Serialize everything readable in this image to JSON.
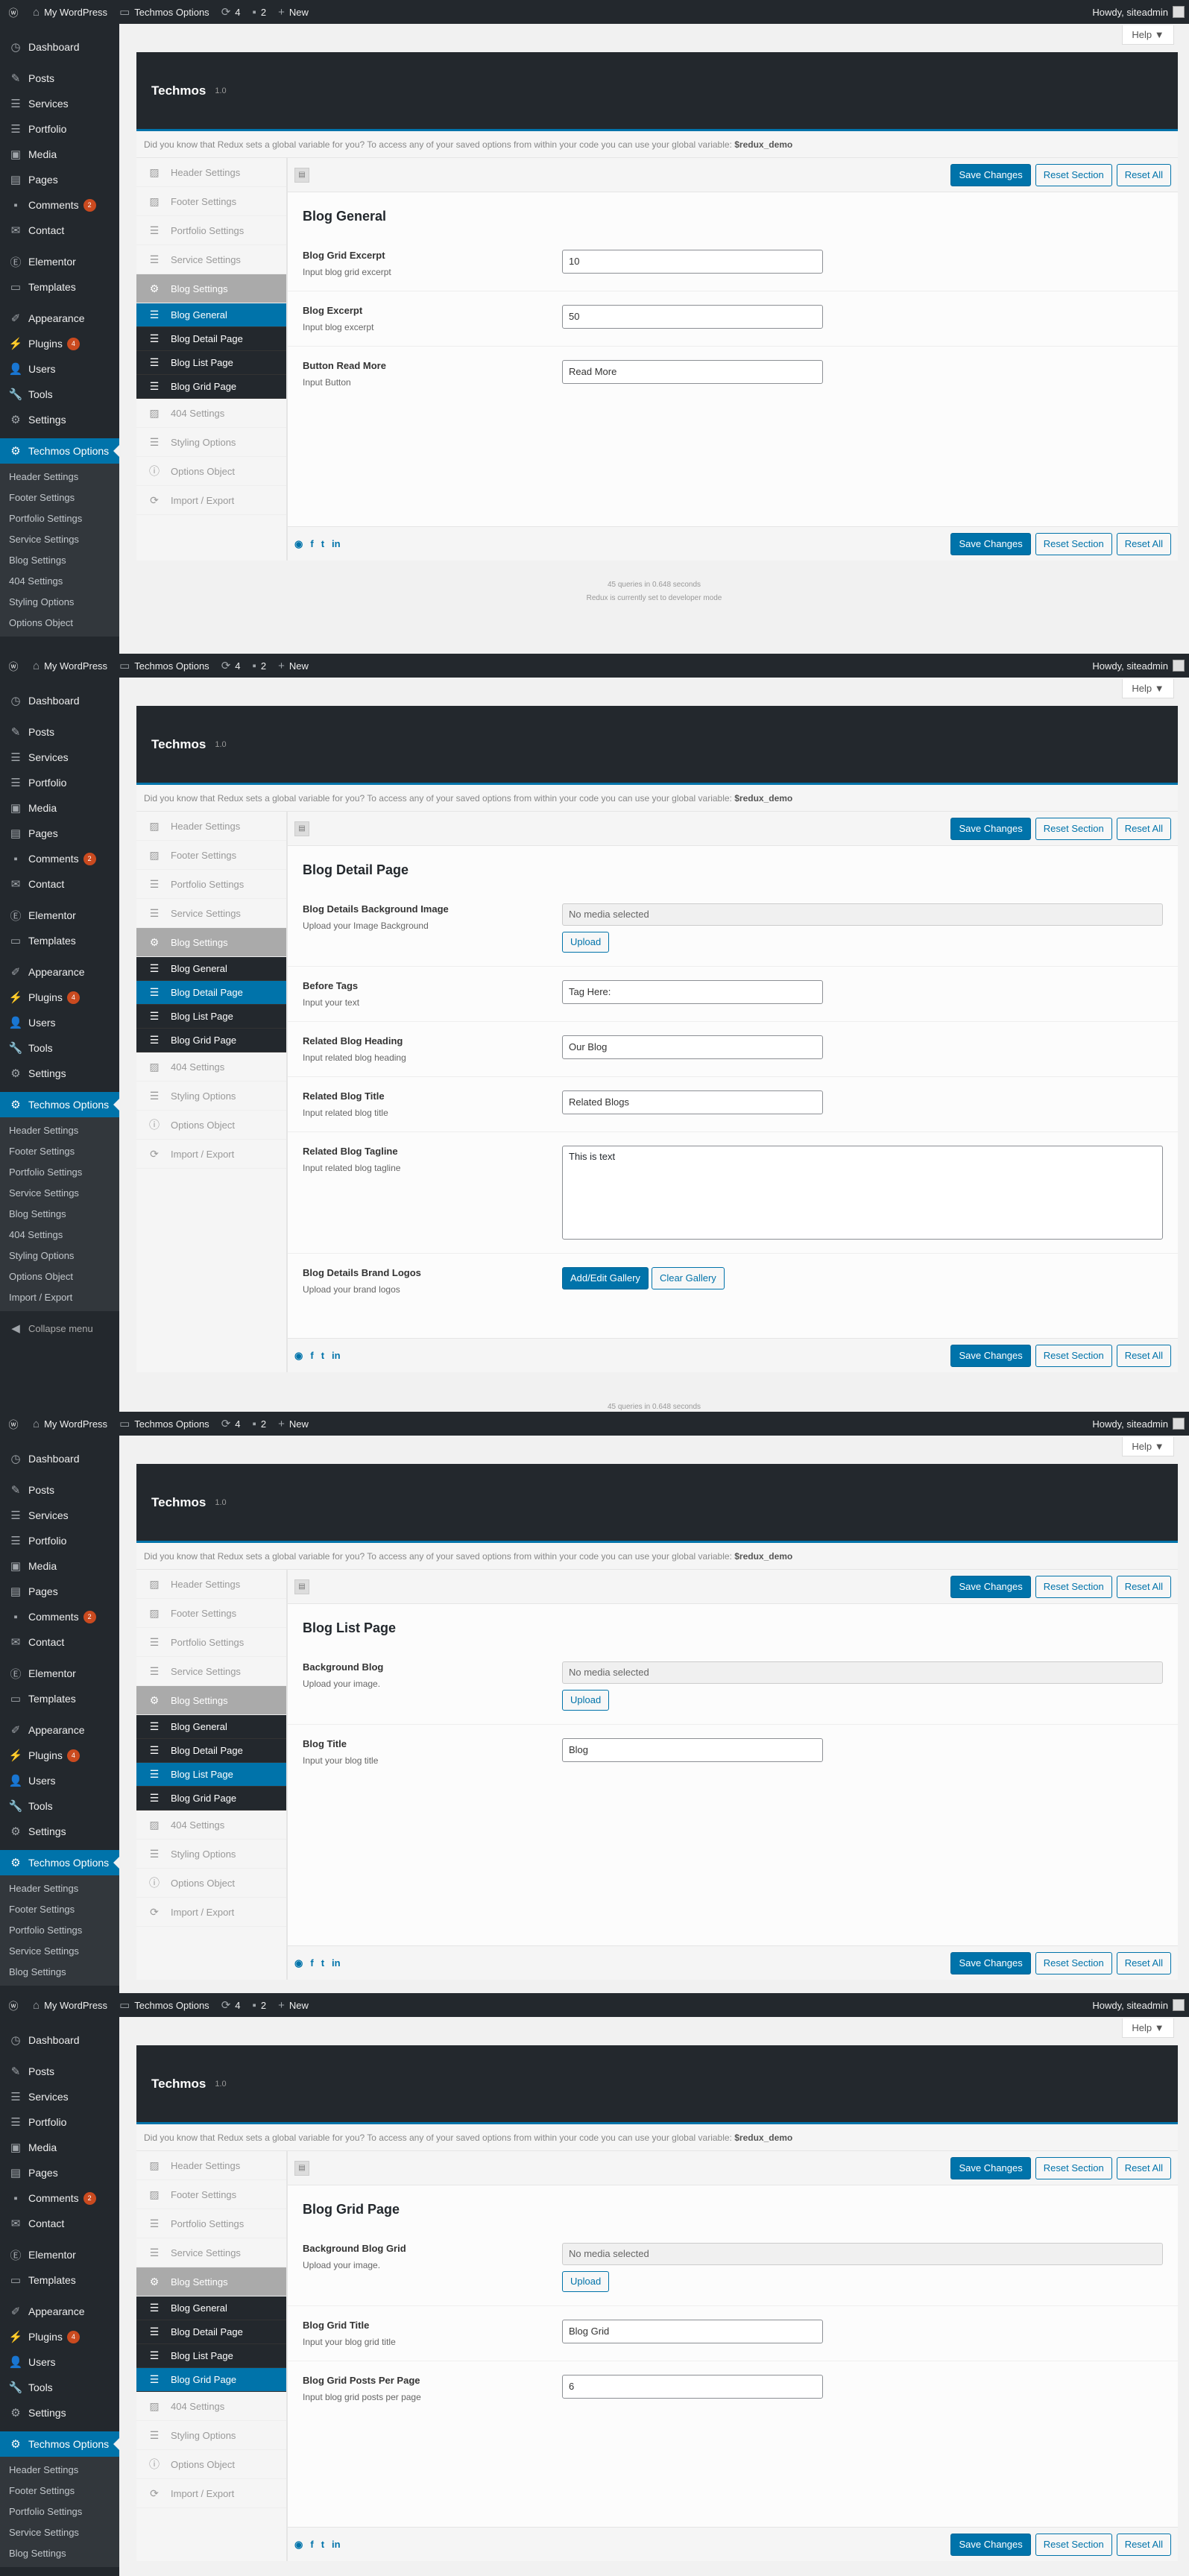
{
  "adminbar": {
    "site": "My WordPress",
    "techmos": "Techmos Options",
    "updates": "4",
    "comments": "2",
    "new": "New",
    "howdy": "Howdy, siteadmin"
  },
  "menu": {
    "dashboard": "Dashboard",
    "posts": "Posts",
    "services": "Services",
    "portfolio": "Portfolio",
    "media": "Media",
    "pages": "Pages",
    "comments": "Comments",
    "comments_badge": "2",
    "contact": "Contact",
    "elementor": "Elementor",
    "templates": "Templates",
    "appearance": "Appearance",
    "plugins": "Plugins",
    "plugins_badge": "4",
    "users": "Users",
    "tools": "Tools",
    "settings": "Settings",
    "techmos_options": "Techmos Options",
    "collapse": "Collapse menu",
    "sub": [
      "Header Settings",
      "Footer Settings",
      "Portfolio Settings",
      "Service Settings",
      "Blog Settings",
      "404 Settings",
      "Styling Options",
      "Options Object",
      "Import / Export"
    ]
  },
  "help": "Help ▼",
  "redux": {
    "title": "Techmos",
    "version": "1.0",
    "notice": "Did you know that Redux sets a global variable for you? To access any of your saved options from within your code you can use your global variable:",
    "notice_var": "$redux_demo",
    "save": "Save Changes",
    "reset_section": "Reset Section",
    "reset_all": "Reset All",
    "sidebar": {
      "header": "Header Settings",
      "footer": "Footer Settings",
      "portfolio": "Portfolio Settings",
      "service": "Service Settings",
      "blog": "Blog Settings",
      "blog_general": "Blog General",
      "blog_detail": "Blog Detail Page",
      "blog_list": "Blog List Page",
      "blog_grid": "Blog Grid Page",
      "s404": "404 Settings",
      "styling": "Styling Options",
      "object": "Options Object",
      "import": "Import / Export"
    }
  },
  "no_media": "No media selected",
  "upload": "Upload",
  "add_gallery": "Add/Edit Gallery",
  "clear_gallery": "Clear Gallery",
  "footer": {
    "queries": "45 queries in 0.648 seconds",
    "dev": "Redux is currently set to developer mode"
  },
  "p1": {
    "title": "Blog General",
    "f1": {
      "label": "Blog Grid Excerpt",
      "desc": "Input blog grid excerpt",
      "value": "10"
    },
    "f2": {
      "label": "Blog Excerpt",
      "desc": "Input blog excerpt",
      "value": "50"
    },
    "f3": {
      "label": "Button Read More",
      "desc": "Input Button",
      "value": "Read More"
    }
  },
  "p2": {
    "title": "Blog Detail Page",
    "f1": {
      "label": "Blog Details Background Image",
      "desc": "Upload your Image Background"
    },
    "f2": {
      "label": "Before Tags",
      "desc": "Input your text",
      "value": "Tag Here:"
    },
    "f3": {
      "label": "Related Blog Heading",
      "desc": "Input related blog heading",
      "value": "Our Blog"
    },
    "f4": {
      "label": "Related Blog Title",
      "desc": "Input related blog title",
      "value": "Related Blogs"
    },
    "f5": {
      "label": "Related Blog Tagline",
      "desc": "Input related blog tagline",
      "value": "This is text"
    },
    "f6": {
      "label": "Blog Details Brand Logos",
      "desc": "Upload your brand logos"
    }
  },
  "p3": {
    "title": "Blog List Page",
    "f1": {
      "label": "Background Blog",
      "desc": "Upload your image."
    },
    "f2": {
      "label": "Blog Title",
      "desc": "Input your blog title",
      "value": "Blog"
    }
  },
  "p4": {
    "title": "Blog Grid Page",
    "f1": {
      "label": "Background Blog Grid",
      "desc": "Upload your image."
    },
    "f2": {
      "label": "Blog Grid Title",
      "desc": "Input your blog grid title",
      "value": "Blog Grid"
    },
    "f3": {
      "label": "Blog Grid Posts Per Page",
      "desc": "Input blog grid posts per page",
      "value": "6"
    }
  }
}
